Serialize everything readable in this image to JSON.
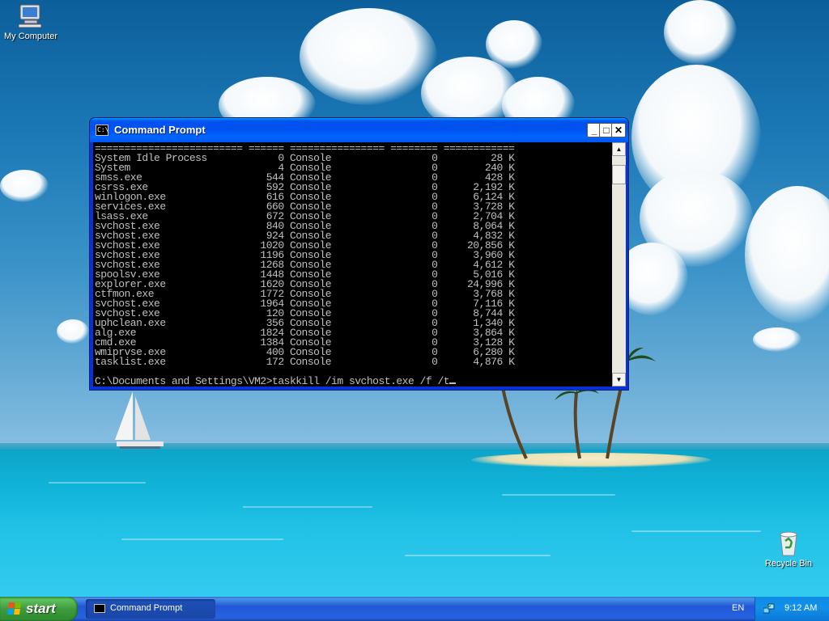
{
  "desktop": {
    "icons": [
      {
        "label": "My Computer",
        "icon": "my-computer-icon"
      },
      {
        "label": "Recycle Bin",
        "icon": "recycle-bin-icon"
      }
    ]
  },
  "window": {
    "title": "Command Prompt",
    "buttons": {
      "minimize": "_",
      "maximize": "□",
      "close": "✕"
    },
    "process_lines": [
      "========================= ====== ================ ======== ============",
      "System Idle Process            0 Console                 0         28 K",
      "System                         4 Console                 0        240 K",
      "smss.exe                     544 Console                 0        428 K",
      "csrss.exe                    592 Console                 0      2,192 K",
      "winlogon.exe                 616 Console                 0      6,124 K",
      "services.exe                 660 Console                 0      3,728 K",
      "lsass.exe                    672 Console                 0      2,704 K",
      "svchost.exe                  840 Console                 0      8,064 K",
      "svchost.exe                  924 Console                 0      4,832 K",
      "svchost.exe                 1020 Console                 0     20,856 K",
      "svchost.exe                 1196 Console                 0      3,960 K",
      "svchost.exe                 1268 Console                 0      4,612 K",
      "spoolsv.exe                 1448 Console                 0      5,016 K",
      "explorer.exe                1620 Console                 0     24,996 K",
      "ctfmon.exe                  1772 Console                 0      3,768 K",
      "svchost.exe                 1964 Console                 0      7,116 K",
      "svchost.exe                  120 Console                 0      8,744 K",
      "uphclean.exe                 356 Console                 0      1,340 K",
      "alg.exe                     1824 Console                 0      3,864 K",
      "cmd.exe                     1384 Console                 0      3,128 K",
      "wmiprvse.exe                 400 Console                 0      6,280 K",
      "tasklist.exe                 172 Console                 0      4,876 K"
    ],
    "prompt": "C:\\Documents and Settings\\VM2>taskkill /im svchost.exe /f /t"
  },
  "taskbar": {
    "start_label": "start",
    "task_label": "Command Prompt",
    "language": "EN",
    "clock": "9:12 AM"
  },
  "colors": {
    "titlebar": "#0054e3",
    "console_bg": "#000000",
    "console_text": "#c0c0c0",
    "start_green": "#3d9c3d",
    "taskbar_blue": "#245edc"
  }
}
